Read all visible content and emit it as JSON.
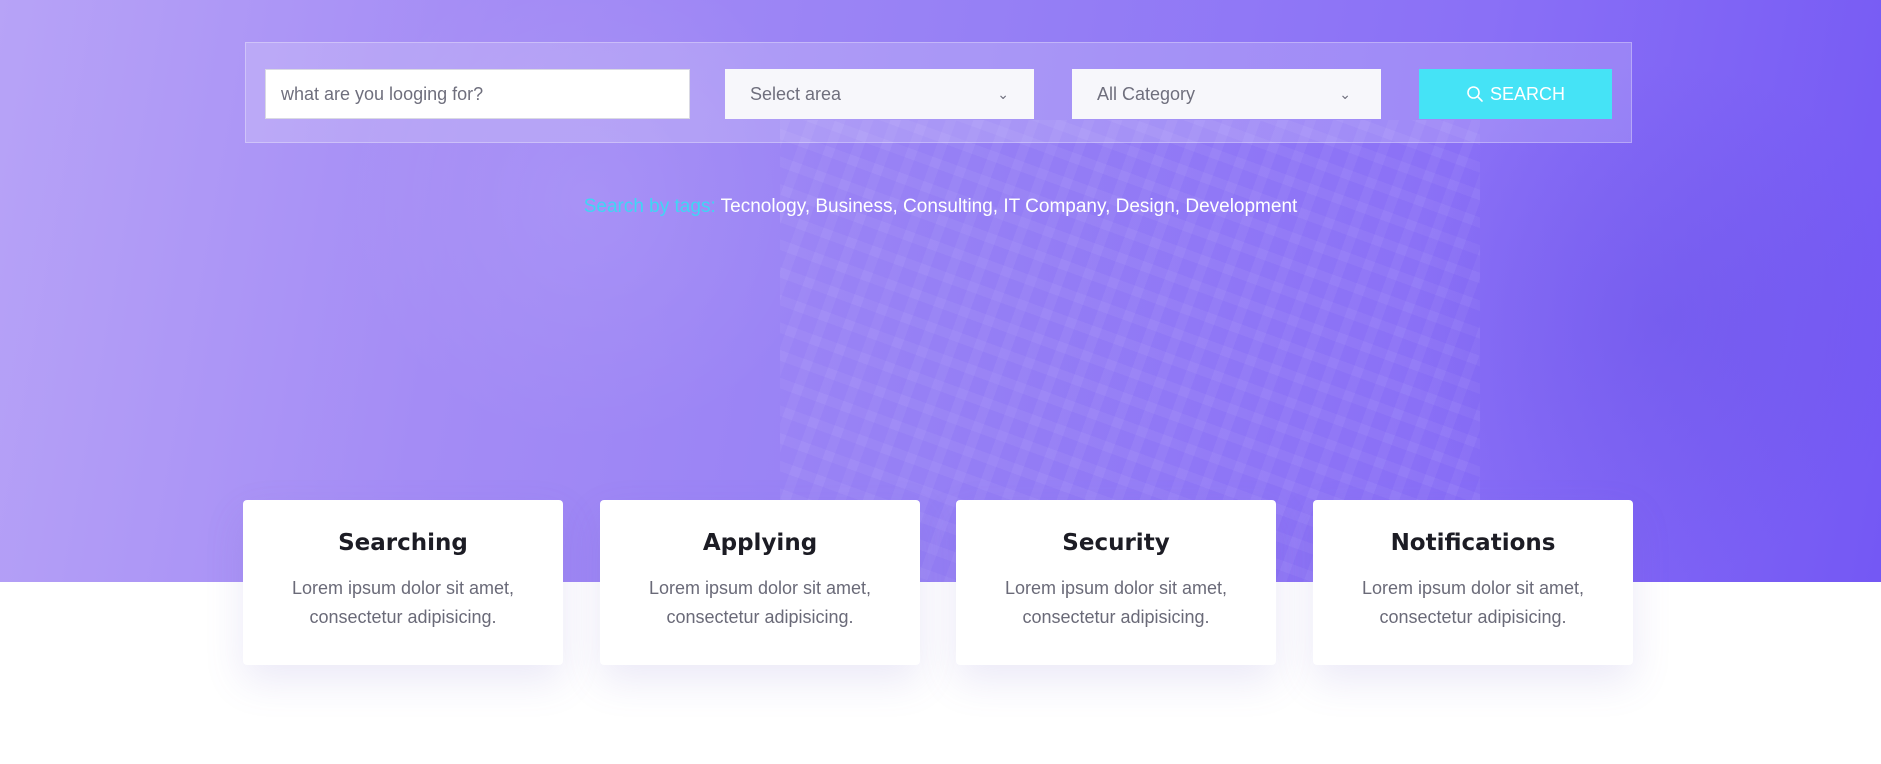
{
  "search": {
    "keyword_placeholder": "what are you looging for?",
    "area_select": "Select area",
    "category_select": "All Category",
    "button_label": "SEARCH",
    "button_icon": "search-icon"
  },
  "tags": {
    "label": "Search by tags:",
    "list": "Tecnology, Business, Consulting, IT Company, Design, Development"
  },
  "features": [
    {
      "title": "Searching",
      "text": "Lorem ipsum dolor sit amet, consectetur adipisicing."
    },
    {
      "title": "Applying",
      "text": "Lorem ipsum dolor sit amet, consectetur adipisicing."
    },
    {
      "title": "Security",
      "text": "Lorem ipsum dolor sit amet, consectetur adipisicing."
    },
    {
      "title": "Notifications",
      "text": "Lorem ipsum dolor sit amet, consectetur adipisicing."
    }
  ],
  "colors": {
    "hero_gradient_start": "#b7a3f7",
    "hero_gradient_end": "#7458f4",
    "accent_cyan": "#45e3f6",
    "tag_label": "#3fd6f4"
  }
}
